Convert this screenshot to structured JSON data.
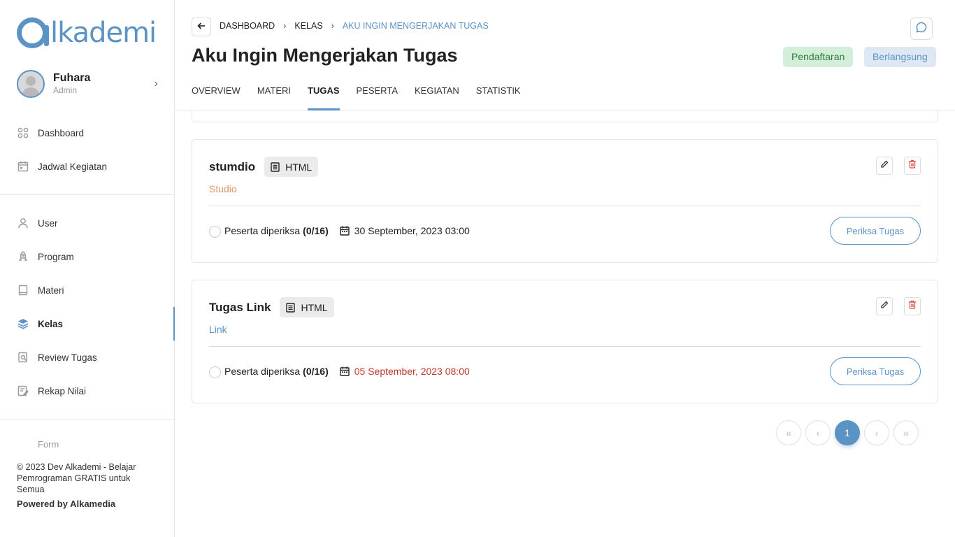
{
  "brand": {
    "logo_text": "lkademi",
    "accent": "#5b93c4"
  },
  "user": {
    "name": "Fuhara",
    "role": "Admin"
  },
  "sidebar": {
    "group1": [
      {
        "label": "Dashboard",
        "icon": "grid-icon"
      },
      {
        "label": "Jadwal Kegiatan",
        "icon": "calendar-icon"
      }
    ],
    "group2": [
      {
        "label": "User",
        "icon": "user-icon"
      },
      {
        "label": "Program",
        "icon": "rocket-icon"
      },
      {
        "label": "Materi",
        "icon": "book-icon"
      },
      {
        "label": "Kelas",
        "icon": "layers-icon",
        "active": true
      },
      {
        "label": "Review Tugas",
        "icon": "review-icon"
      },
      {
        "label": "Rekap Nilai",
        "icon": "edit-note-icon"
      }
    ],
    "cut_item": "Form",
    "footer_text": "© 2023 Dev Alkademi - Belajar Pemrograman GRATIS untuk Semua",
    "powered_by": "Powered by Alkamedia"
  },
  "breadcrumb": {
    "items": [
      "DASHBOARD",
      "KELAS"
    ],
    "current": "AKU INGIN MENGERJAKAN TUGAS"
  },
  "page": {
    "title": "Aku Ingin Mengerjakan Tugas",
    "badges": {
      "registration": "Pendaftaran",
      "ongoing": "Berlangsung"
    }
  },
  "tabs": [
    {
      "label": "OVERVIEW"
    },
    {
      "label": "MATERI"
    },
    {
      "label": "TUGAS",
      "active": true
    },
    {
      "label": "PESERTA"
    },
    {
      "label": "KEGIATAN"
    },
    {
      "label": "STATISTIK"
    }
  ],
  "tasks": [
    {
      "title": "stumdio",
      "type": "HTML",
      "subtitle": "Studio",
      "subtitle_color": "#e39867",
      "checked_label": "Peserta diperiksa",
      "checked_count": "(0/16)",
      "deadline": "30 September, 2023 03:00",
      "deadline_color": "#222222",
      "button": "Periksa Tugas"
    },
    {
      "title": "Tugas Link",
      "type": "HTML",
      "subtitle": "Link",
      "subtitle_color": "#5b93c4",
      "checked_label": "Peserta diperiksa",
      "checked_count": "(0/16)",
      "deadline": "05 September, 2023 08:00",
      "deadline_color": "#c0392b",
      "button": "Periksa Tugas"
    }
  ],
  "pagination": {
    "first": "«",
    "prev": "‹",
    "current": "1",
    "next": "›",
    "last": "»"
  }
}
